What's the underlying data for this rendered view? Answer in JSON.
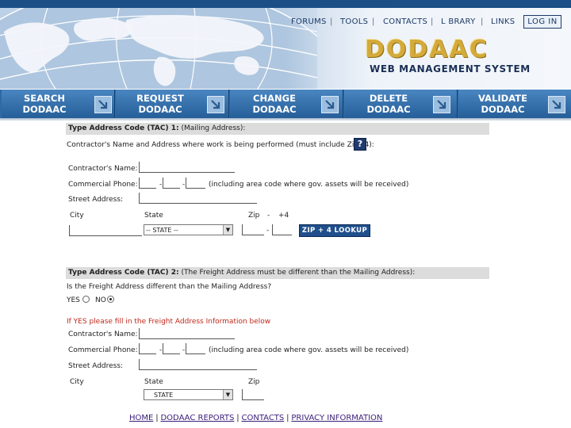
{
  "header": {
    "links": [
      "FORUMS",
      "TOOLS",
      "CONTACTS",
      "L BRARY",
      "LINKS"
    ],
    "separator": "|",
    "login": "LOG IN",
    "logo": "DODAAC",
    "subtitle": "WEB MANAGEMENT SYSTEM"
  },
  "nav": [
    {
      "line1": "SEARCH",
      "line2": "DODAAC"
    },
    {
      "line1": "REQUEST",
      "line2": "DODAAC"
    },
    {
      "line1": "CHANGE",
      "line2": "DODAAC"
    },
    {
      "line1": "DELETE",
      "line2": "DODAAC"
    },
    {
      "line1": "VALIDATE",
      "line2": "DODAAC"
    }
  ],
  "tac1": {
    "title": "Type Address Code (TAC) 1:",
    "subtitle": "(Mailing Address):",
    "intro": "Contractor's Name and Address where work is being performed (must include Zip+4):",
    "help": "?",
    "name_label": "Contractor's Name:",
    "phone_label": "Commercial Phone:",
    "phone_dash": "-",
    "phone_note": "(including area code where gov. assets will be received)",
    "street_label": "Street Address:",
    "city_label": "City",
    "state_label": "State",
    "zip_label": "Zip",
    "zip_dash": "-",
    "plus4_label": "+4",
    "state_value": "-- STATE --",
    "zip_button": "ZIP + 4 LOOKUP"
  },
  "tac2": {
    "title": "Type Address Code (TAC) 2:",
    "subtitle": "(The Freight Address must be different than the Mailing Address):",
    "question": "Is the Freight Address different than the Mailing Address?",
    "yes": "YES",
    "no": "NO",
    "selected": "NO",
    "instruction": "If YES please fill in the Freight Address Information below",
    "name_label": "Contractor's Name:",
    "phone_label": "Commercial Phone:",
    "phone_dash": "-",
    "phone_note": "(including area code where gov. assets will be received)",
    "street_label": "Street Address:",
    "city_label": "City",
    "state_label": "State",
    "zip_label": "Zip",
    "state_value": "STATE"
  },
  "footer": {
    "links": [
      "HOME",
      "DODAAC REPORTS",
      "CONTACTS",
      "PRIVACY INFORMATION"
    ],
    "separator": "|"
  },
  "colors": {
    "nav_blue": "#2d6ba8",
    "logo_gold": "#d4aa3a",
    "accent_red": "#c0281c",
    "header_navy": "#1c4f86"
  }
}
